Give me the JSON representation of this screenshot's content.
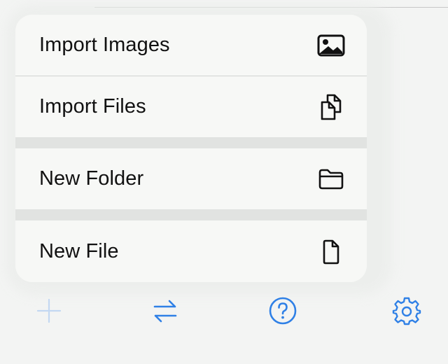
{
  "menu": {
    "items": [
      {
        "label": "Import Images",
        "icon": "photo-icon"
      },
      {
        "label": "Import Files",
        "icon": "documents-icon"
      },
      {
        "label": "New Folder",
        "icon": "folder-icon"
      },
      {
        "label": "New File",
        "icon": "file-icon"
      }
    ]
  },
  "toolbar": {
    "buttons": [
      {
        "icon": "plus-icon",
        "enabled": false
      },
      {
        "icon": "swap-arrows-icon",
        "enabled": true
      },
      {
        "icon": "help-circle-icon",
        "enabled": true
      },
      {
        "icon": "gear-icon",
        "enabled": true
      }
    ]
  },
  "colors": {
    "accent": "#2f80e6",
    "disabled": "#c3d8f2",
    "menu_background": "#f7f8f6",
    "page_background": "#f3f4f3",
    "text": "#111111"
  }
}
